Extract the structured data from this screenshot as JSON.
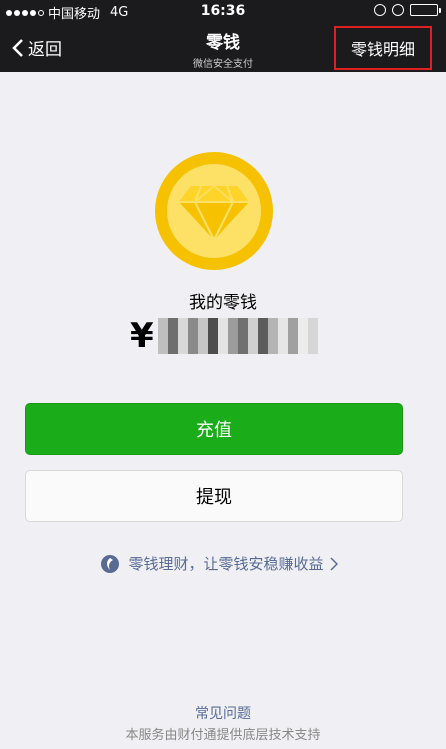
{
  "status_bar": {
    "carrier": "中国移动",
    "network": "4G",
    "time": "16:36"
  },
  "nav": {
    "back_label": "返回",
    "title": "零钱",
    "subtitle": "微信安全支付",
    "detail_label": "零钱明细"
  },
  "balance": {
    "label": "我的零钱",
    "currency_symbol": "¥"
  },
  "actions": {
    "recharge_label": "充值",
    "withdraw_label": "提现"
  },
  "finance": {
    "link_text": "零钱理财，让零钱安稳赚收益"
  },
  "footer": {
    "faq_label": "常见问题",
    "note": "本服务由财付通提供底层技术支持"
  },
  "colors": {
    "nav_bg": "#1b1b1d",
    "primary_green": "#1aad19",
    "link_blue": "#576b95",
    "highlight_red": "#e02020",
    "coin_gold": "#f6c200"
  }
}
